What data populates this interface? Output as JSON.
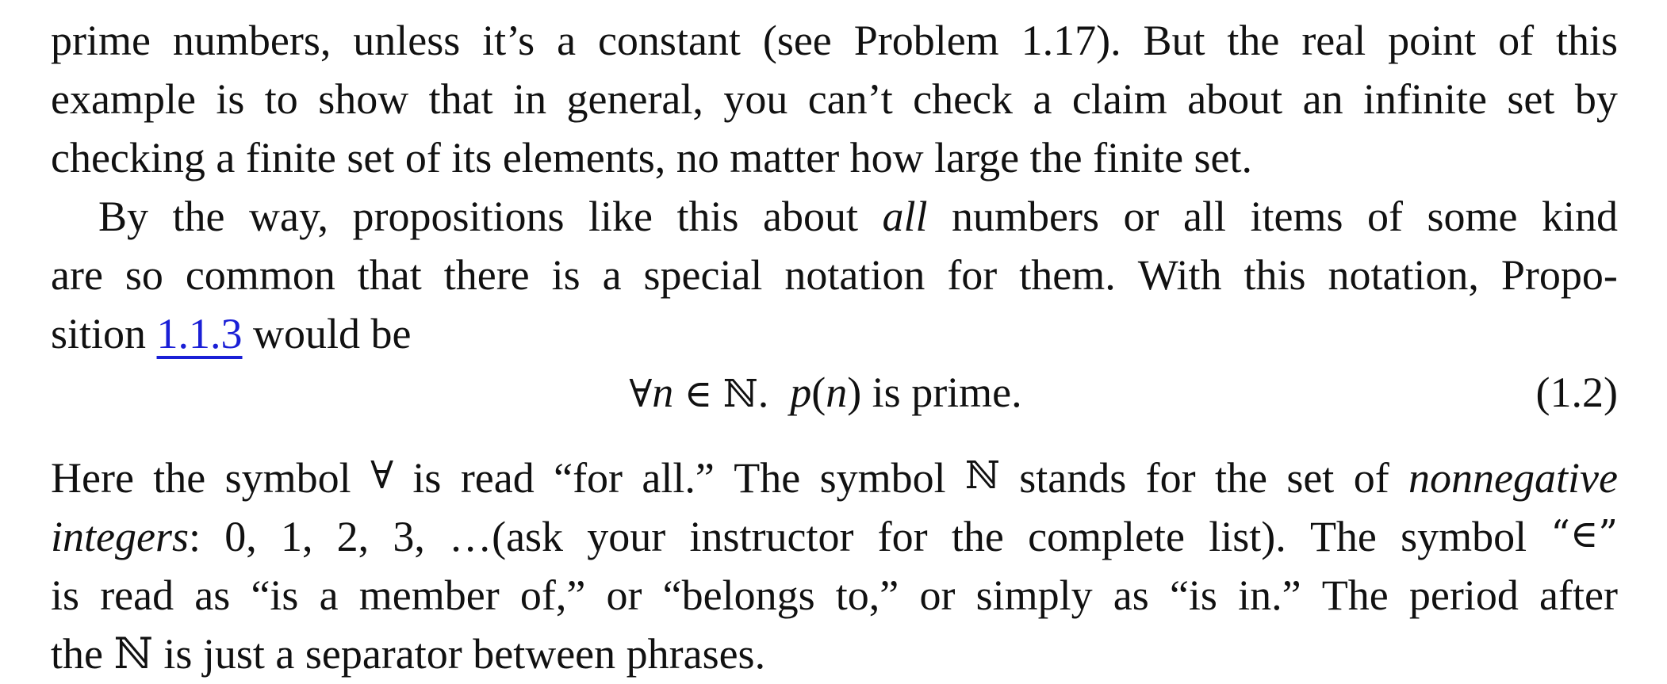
{
  "paragraph1": {
    "line1_words": [
      "prime",
      "numbers,",
      "unless",
      "it’s",
      "a",
      "constant",
      "(see",
      "Problem",
      "1.17).",
      "But",
      "the",
      "real",
      "point",
      "of",
      "this"
    ],
    "line2_words": [
      "example",
      "is",
      "to",
      "show",
      "that",
      "in",
      "general,",
      "you",
      "can’t",
      "check",
      "a",
      "claim",
      "about",
      "an",
      "infinite",
      "set",
      "by"
    ],
    "line3": "checking a finite set of its elements, no matter how large the finite set."
  },
  "paragraph2": {
    "line1_before_italic": [
      "By",
      "the",
      "way,",
      "propositions",
      "like",
      "this",
      "about"
    ],
    "line1_italic": "all",
    "line1_after_italic": [
      "numbers",
      "or",
      "all",
      "items",
      "of",
      "some",
      "kind"
    ],
    "line2_words": [
      "are",
      "so",
      "common",
      "that",
      "there",
      "is",
      "a",
      "special",
      "notation",
      "for",
      "them.",
      "With",
      "this",
      "notation,",
      "Propo-"
    ],
    "line3_before_link": "sition ",
    "line3_link": "1.1.3",
    "line3_after_link": " would be"
  },
  "equation": {
    "forall": "∀",
    "var_n": "n",
    "member": "∈",
    "naturals": "ℕ",
    "sep": ".",
    "func_p": "p",
    "open_paren": "(",
    "arg_n": "n",
    "close_paren": ")",
    "tail": " is prime.",
    "number": "(1.2)"
  },
  "paragraph3": {
    "line1_before": [
      "Here",
      "the",
      "symbol",
      "∀",
      "is",
      "read",
      "“for",
      "all.”",
      "The",
      "symbol",
      "ℕ",
      "stands",
      "for",
      "the",
      "set",
      "of"
    ],
    "line1_italic": "nonnegative",
    "line2_italic": "integers",
    "line2_rest": [
      "0,",
      "1,",
      "2,",
      "3,",
      "…(ask",
      "your",
      "instructor",
      "for",
      "the",
      "complete",
      "list).",
      "The",
      "symbol",
      "“∈”"
    ],
    "line3_words": [
      "is",
      "read",
      "as",
      "“is",
      "a",
      "member",
      "of,”",
      "or",
      "“belongs",
      "to,”",
      "or",
      "simply",
      "as",
      "“is",
      "in.”",
      "The",
      "period",
      "after"
    ],
    "line4": "the ℕ is just a separator between phrases."
  },
  "colors": {
    "text": "#111111",
    "link": "#1a1fd6",
    "background": "#ffffff"
  }
}
